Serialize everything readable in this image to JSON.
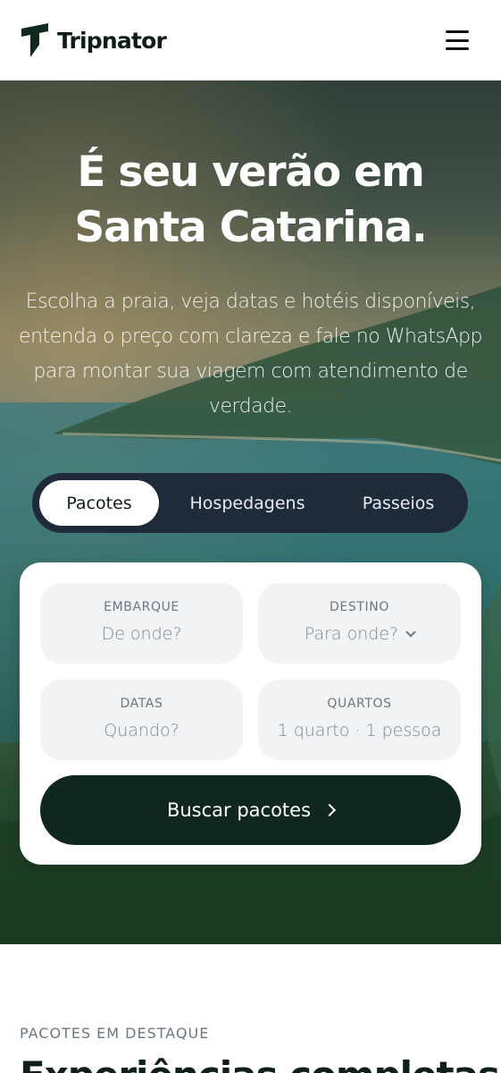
{
  "header": {
    "brand_name": "Tripnator",
    "logo_icon": "tripnator-logo-icon",
    "menu_icon": "hamburger-menu-icon"
  },
  "hero": {
    "title": "É seu verão em Santa Catarina.",
    "subtitle": "Escolha a praia, veja datas e hotéis disponíveis, entenda o preço com clareza e fale no WhatsApp para montar sua viagem com atendimento de verdade."
  },
  "tabs": [
    {
      "label": "Pacotes",
      "active": true
    },
    {
      "label": "Hospedagens",
      "active": false
    },
    {
      "label": "Passeios",
      "active": false
    }
  ],
  "search": {
    "embarque": {
      "label": "EMBARQUE",
      "placeholder": "De onde?"
    },
    "destino": {
      "label": "DESTINO",
      "placeholder": "Para onde?"
    },
    "datas": {
      "label": "DATAS",
      "placeholder": "Quando?"
    },
    "quartos": {
      "label": "QUARTOS",
      "value": "1 quarto · 1 pessoa"
    },
    "submit_label": "Buscar pacotes"
  },
  "featured": {
    "eyebrow": "PACOTES EM DESTAQUE",
    "title": "Experiências completas"
  },
  "colors": {
    "brand_dark": "#0f271c",
    "tabs_bg": "#1f2a3a",
    "field_bg": "#f1f3f5"
  }
}
